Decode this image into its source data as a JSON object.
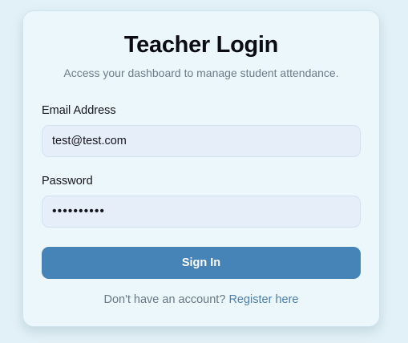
{
  "login": {
    "title": "Teacher Login",
    "subtitle": "Access your dashboard to manage student attendance.",
    "email": {
      "label": "Email Address",
      "value": "test@test.com"
    },
    "password": {
      "label": "Password",
      "value": "••••••••••"
    },
    "submit_label": "Sign In",
    "footer_text": "Don't have an account? ",
    "register_link": "Register here"
  },
  "colors": {
    "page_background": "#e2f1f7",
    "card_background": "#ecf7fb",
    "input_background": "#e6eff9",
    "primary_button": "#4683b6",
    "link": "#4a7fb0",
    "muted_text": "#6c7c88"
  }
}
